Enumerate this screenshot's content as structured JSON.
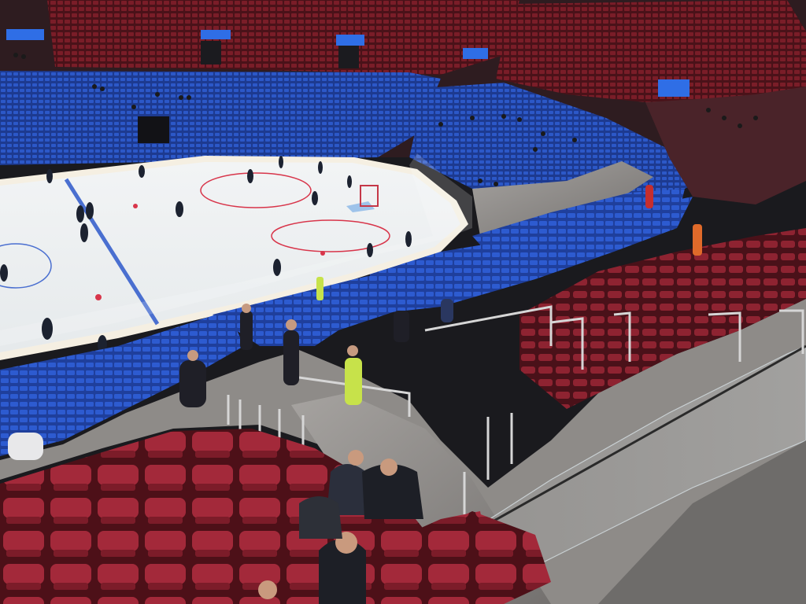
{
  "scene": {
    "description_label": "",
    "screen_text": ""
  },
  "colors": {
    "ice": "#eef1f2",
    "board_ad": "#f6f0e6",
    "blue_line": "#4a6fd0",
    "red_line": "#d8354a",
    "seat_blue": "#2b57c9",
    "seat_blue_dark": "#1e3f98",
    "seat_red": "#9a2330",
    "seat_red_dark": "#5e141d",
    "concrete": "#8d8b89",
    "upper_wall": "#3a2326",
    "screen_blue": "#2f6ee6"
  }
}
